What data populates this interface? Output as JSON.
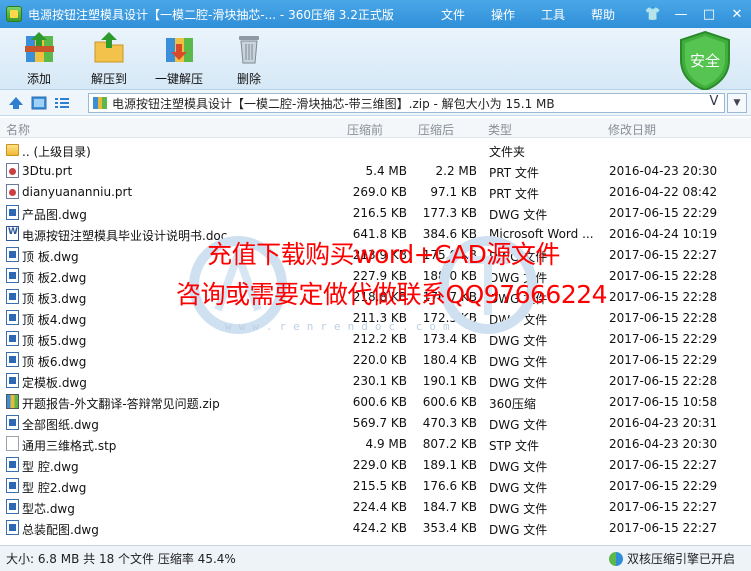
{
  "window": {
    "title": "电源按钮注塑模具设计【一模二腔-滑块抽芯-... - 360压缩 3.2正式版",
    "menu": [
      "文件",
      "操作",
      "工具",
      "帮助"
    ],
    "controls": {
      "skin": "👕",
      "minimize": "—",
      "maximize": "□",
      "close": "✕"
    }
  },
  "toolbar": {
    "buttons": [
      {
        "label": "添加",
        "icon": "add-archive-icon"
      },
      {
        "label": "解压到",
        "icon": "extract-to-icon"
      },
      {
        "label": "一键解压",
        "icon": "one-click-extract-icon"
      },
      {
        "label": "删除",
        "icon": "trash-icon"
      }
    ],
    "security_label": "安全"
  },
  "address": {
    "path": "电源按钮注塑模具设计【一模二腔-滑块抽芯-带三维图】.zip - 解包大小为 15.1 MB",
    "verify_glyph": "V"
  },
  "columns": {
    "name": "名称",
    "compressed": "压缩前",
    "packed": "压缩后",
    "type": "类型",
    "modified": "修改日期"
  },
  "files": [
    {
      "name": ".. (上级目录)",
      "compressed": "",
      "packed": "",
      "type": "文件夹",
      "date": "",
      "icon": "folder"
    },
    {
      "name": "3Dtu.prt",
      "compressed": "5.4 MB",
      "packed": "2.2 MB",
      "type": "PRT 文件",
      "date": "2016-04-23 20:30",
      "icon": "prt"
    },
    {
      "name": "dianyuananniu.prt",
      "compressed": "269.0 KB",
      "packed": "97.1 KB",
      "type": "PRT 文件",
      "date": "2016-04-22 08:42",
      "icon": "prt"
    },
    {
      "name": "产品图.dwg",
      "compressed": "216.5 KB",
      "packed": "177.3 KB",
      "type": "DWG 文件",
      "date": "2017-06-15 22:29",
      "icon": "dwg"
    },
    {
      "name": "电源按钮注塑模具毕业设计说明书.doc",
      "compressed": "641.8 KB",
      "packed": "384.6 KB",
      "type": "Microsoft Word ...",
      "date": "2016-04-24 10:19",
      "icon": "doc"
    },
    {
      "name": "顶 板.dwg",
      "compressed": "213.9 KB",
      "packed": "175.0 KB",
      "type": "DWG 文件",
      "date": "2017-06-15 22:27",
      "icon": "dwg"
    },
    {
      "name": "顶 板2.dwg",
      "compressed": "227.9 KB",
      "packed": "188.0 KB",
      "type": "DWG 文件",
      "date": "2017-06-15 22:28",
      "icon": "dwg"
    },
    {
      "name": "顶 板3.dwg",
      "compressed": "218.8 KB",
      "packed": "176.7 KB",
      "type": "DWG 文件",
      "date": "2017-06-15 22:28",
      "icon": "dwg"
    },
    {
      "name": "顶 板4.dwg",
      "compressed": "211.3 KB",
      "packed": "172.5 KB",
      "type": "DWG 文件",
      "date": "2017-06-15 22:28",
      "icon": "dwg"
    },
    {
      "name": "顶 板5.dwg",
      "compressed": "212.2 KB",
      "packed": "173.4 KB",
      "type": "DWG 文件",
      "date": "2017-06-15 22:29",
      "icon": "dwg"
    },
    {
      "name": "顶 板6.dwg",
      "compressed": "220.0 KB",
      "packed": "180.4 KB",
      "type": "DWG 文件",
      "date": "2017-06-15 22:29",
      "icon": "dwg"
    },
    {
      "name": "定模板.dwg",
      "compressed": "230.1 KB",
      "packed": "190.1 KB",
      "type": "DWG 文件",
      "date": "2017-06-15 22:28",
      "icon": "dwg"
    },
    {
      "name": "开题报告-外文翻译-答辩常见问题.zip",
      "compressed": "600.6 KB",
      "packed": "600.6 KB",
      "type": "360压缩",
      "date": "2017-06-15 10:58",
      "icon": "zip"
    },
    {
      "name": "全部图纸.dwg",
      "compressed": "569.7 KB",
      "packed": "470.3 KB",
      "type": "DWG 文件",
      "date": "2016-04-23 20:31",
      "icon": "dwg"
    },
    {
      "name": "通用三维格式.stp",
      "compressed": "4.9 MB",
      "packed": "807.2 KB",
      "type": "STP 文件",
      "date": "2016-04-23 20:30",
      "icon": "stp"
    },
    {
      "name": "型 腔.dwg",
      "compressed": "229.0 KB",
      "packed": "189.1 KB",
      "type": "DWG 文件",
      "date": "2017-06-15 22:27",
      "icon": "dwg"
    },
    {
      "name": "型 腔2.dwg",
      "compressed": "215.5 KB",
      "packed": "176.6 KB",
      "type": "DWG 文件",
      "date": "2017-06-15 22:29",
      "icon": "dwg"
    },
    {
      "name": "型芯.dwg",
      "compressed": "224.4 KB",
      "packed": "184.7 KB",
      "type": "DWG 文件",
      "date": "2017-06-15 22:27",
      "icon": "dwg"
    },
    {
      "name": "总装配图.dwg",
      "compressed": "424.2 KB",
      "packed": "353.4 KB",
      "type": "DWG 文件",
      "date": "2017-06-15 22:27",
      "icon": "dwg"
    }
  ],
  "overlay": {
    "line1": "充值下载购买word+CAD源文件",
    "line2": "咨询或需要定做代做联系QQ97666224",
    "watermark_url": "www.renrendoc.com"
  },
  "status": {
    "summary": "大小: 6.8 MB 共 18 个文件 压缩率 45.4%",
    "engine": "双核压缩引擎已开启"
  }
}
